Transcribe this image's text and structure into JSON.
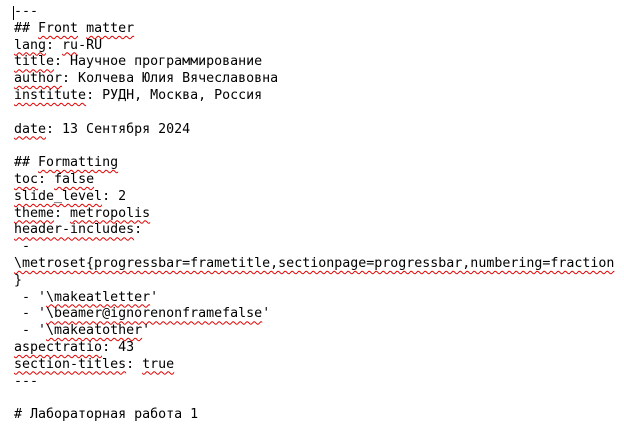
{
  "editor": {
    "lines": [
      {
        "segments": [
          {
            "t": "---",
            "sq": false
          }
        ]
      },
      {
        "segments": [
          {
            "t": "## ",
            "sq": false
          },
          {
            "t": "Front",
            "sq": true
          },
          {
            "t": " ",
            "sq": false
          },
          {
            "t": "matter",
            "sq": true
          }
        ]
      },
      {
        "segments": [
          {
            "t": "lang",
            "sq": true
          },
          {
            "t": ": ",
            "sq": false
          },
          {
            "t": "ru",
            "sq": true
          },
          {
            "t": "-RU",
            "sq": false
          }
        ]
      },
      {
        "segments": [
          {
            "t": "title",
            "sq": true
          },
          {
            "t": ": Научное программирование",
            "sq": false
          }
        ]
      },
      {
        "segments": [
          {
            "t": "author",
            "sq": true
          },
          {
            "t": ": Колчева Юлия Вячеславовна",
            "sq": false
          }
        ]
      },
      {
        "segments": [
          {
            "t": "institute",
            "sq": true
          },
          {
            "t": ": РУДН, Москва, Россия",
            "sq": false
          }
        ]
      },
      {
        "segments": []
      },
      {
        "segments": [
          {
            "t": "date",
            "sq": true
          },
          {
            "t": ": 13 Сентября 2024",
            "sq": false
          }
        ]
      },
      {
        "segments": []
      },
      {
        "segments": [
          {
            "t": "## ",
            "sq": false
          },
          {
            "t": "Formatting",
            "sq": true
          }
        ]
      },
      {
        "segments": [
          {
            "t": "toc",
            "sq": true
          },
          {
            "t": ": ",
            "sq": false
          },
          {
            "t": "false",
            "sq": true
          }
        ]
      },
      {
        "segments": [
          {
            "t": "slide_level",
            "sq": true
          },
          {
            "t": ": 2",
            "sq": false
          }
        ]
      },
      {
        "segments": [
          {
            "t": "theme",
            "sq": true
          },
          {
            "t": ": ",
            "sq": false
          },
          {
            "t": "metropolis",
            "sq": true
          }
        ]
      },
      {
        "segments": [
          {
            "t": "header-includes",
            "sq": true
          },
          {
            "t": ":",
            "sq": false
          }
        ]
      },
      {
        "segments": [
          {
            "t": " -",
            "sq": false
          }
        ]
      },
      {
        "segments": [
          {
            "t": "\\metroset{progressbar=frametitle,sectionpage=progressbar,numbering=fraction",
            "sq": true
          }
        ]
      },
      {
        "segments": [
          {
            "t": "}",
            "sq": false
          }
        ]
      },
      {
        "segments": [
          {
            "t": " - '",
            "sq": false
          },
          {
            "t": "\\makeatletter",
            "sq": true
          },
          {
            "t": "'",
            "sq": false
          }
        ]
      },
      {
        "segments": [
          {
            "t": " - '",
            "sq": false
          },
          {
            "t": "\\beamer@ignorenonframefalse",
            "sq": true
          },
          {
            "t": "'",
            "sq": false
          }
        ]
      },
      {
        "segments": [
          {
            "t": " - '",
            "sq": false
          },
          {
            "t": "\\makeatother",
            "sq": true
          },
          {
            "t": "'",
            "sq": false
          }
        ]
      },
      {
        "segments": [
          {
            "t": "aspectratio",
            "sq": true
          },
          {
            "t": ": 43",
            "sq": false
          }
        ]
      },
      {
        "segments": [
          {
            "t": "section-titles",
            "sq": true
          },
          {
            "t": ": ",
            "sq": false
          },
          {
            "t": "true",
            "sq": true
          }
        ]
      },
      {
        "segments": [
          {
            "t": "---",
            "sq": false
          }
        ]
      },
      {
        "segments": []
      },
      {
        "segments": [
          {
            "t": "# Лабораторная работа 1",
            "sq": false
          }
        ]
      }
    ]
  }
}
